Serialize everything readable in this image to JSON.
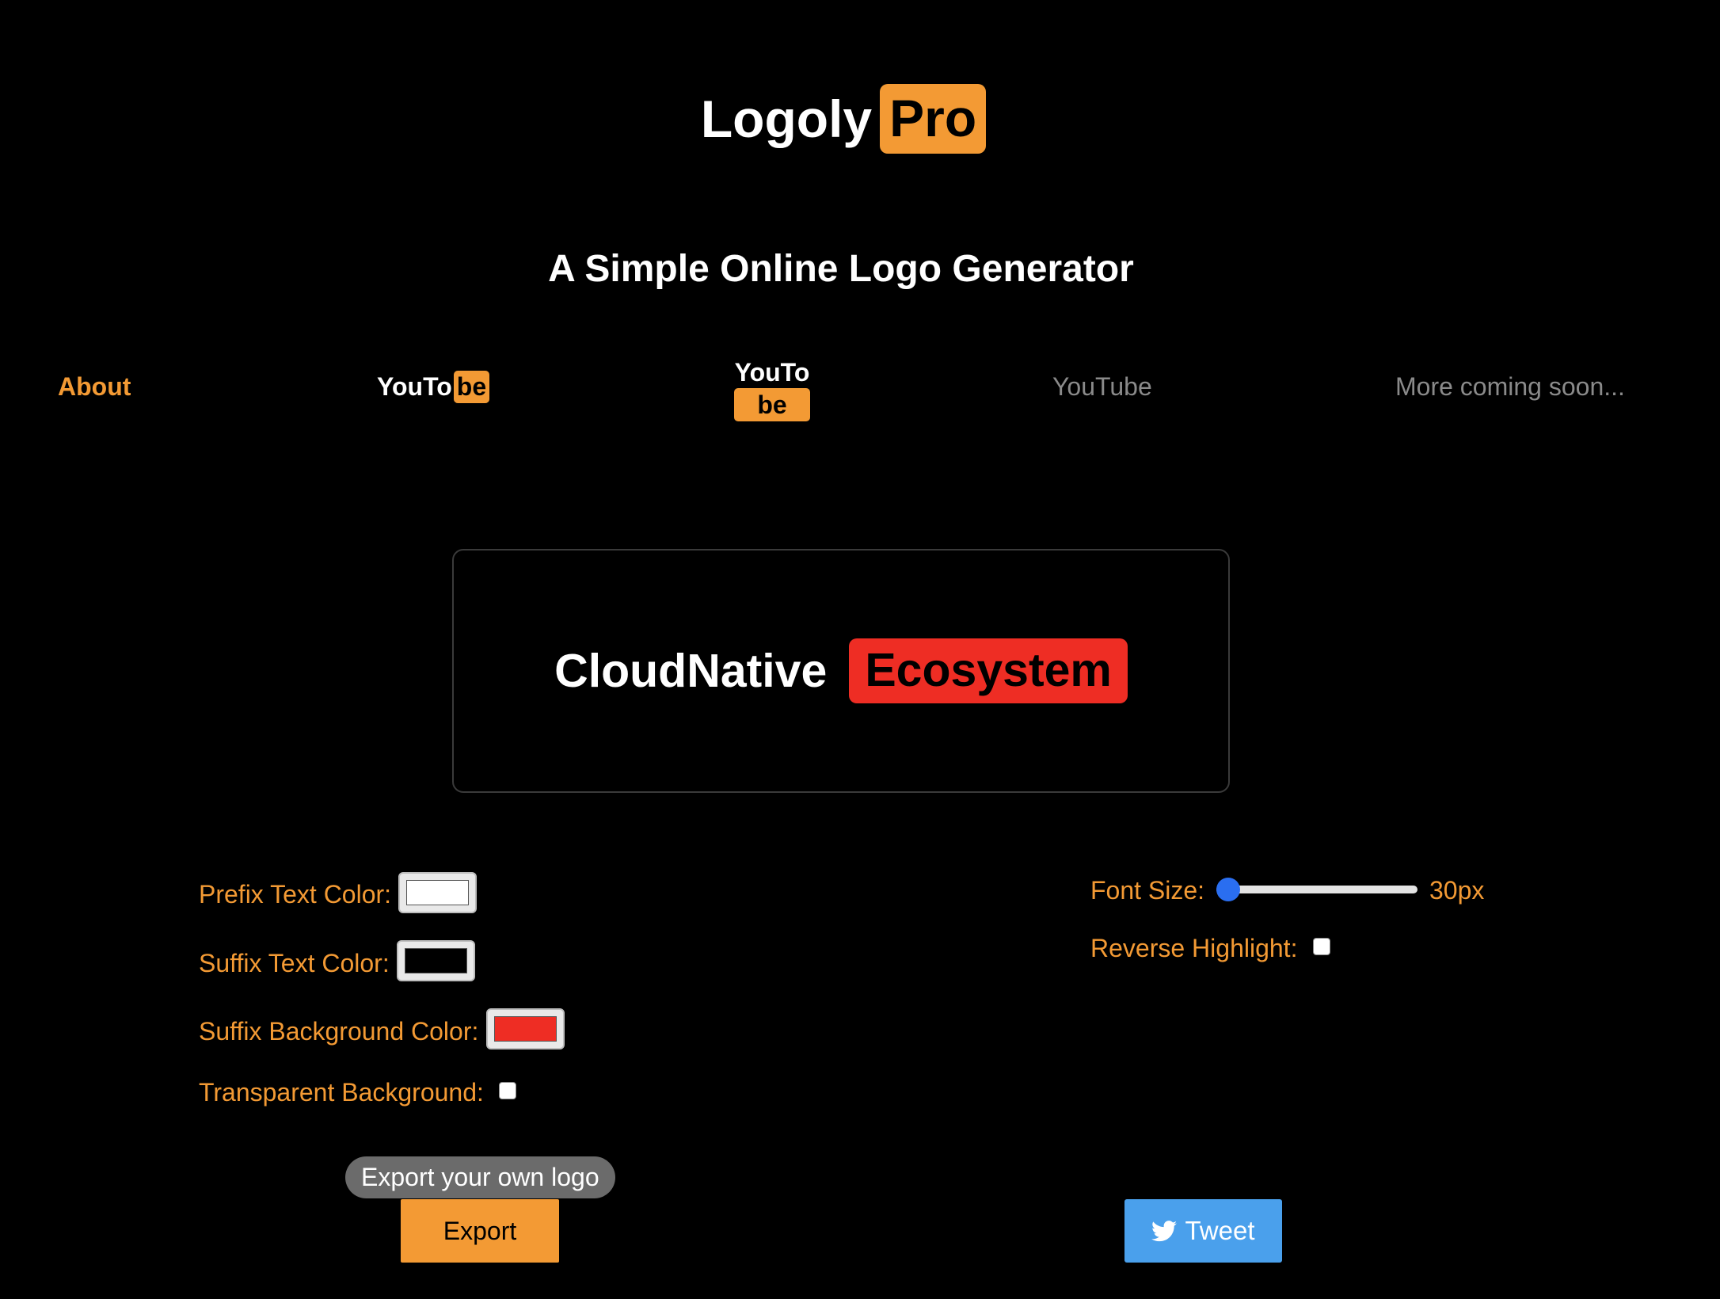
{
  "header": {
    "logo_prefix": "Logoly",
    "logo_suffix": "Pro",
    "subtitle": "A Simple Online Logo Generator"
  },
  "nav": {
    "about": "About",
    "style_inline": {
      "prefix": "YouTo",
      "suffix": "be"
    },
    "style_stacked": {
      "prefix": "YouTo",
      "suffix": "be"
    },
    "style_plain": "YouTube",
    "more": "More coming soon..."
  },
  "preview": {
    "prefix": "CloudNative",
    "suffix": "Ecosystem",
    "prefix_color": "#ffffff",
    "suffix_color": "#000000",
    "suffix_bg_color": "#ee2d24"
  },
  "controls": {
    "prefix_text_color_label": "Prefix Text Color:",
    "suffix_text_color_label": "Suffix Text Color:",
    "suffix_bg_color_label": "Suffix Background Color:",
    "transparent_bg_label": "Transparent Background:",
    "transparent_bg_checked": false,
    "font_size_label": "Font Size:",
    "font_size_value": "30px",
    "font_size_slider_fraction": 0,
    "reverse_highlight_label": "Reverse Highlight:",
    "reverse_highlight_checked": false
  },
  "actions": {
    "export_tooltip": "Export your own logo",
    "export_label": "Export",
    "tweet_label": "Tweet"
  },
  "colors": {
    "accent": "#f39a34",
    "tweet": "#4aa0ec",
    "slider_thumb": "#2a6ef0"
  }
}
